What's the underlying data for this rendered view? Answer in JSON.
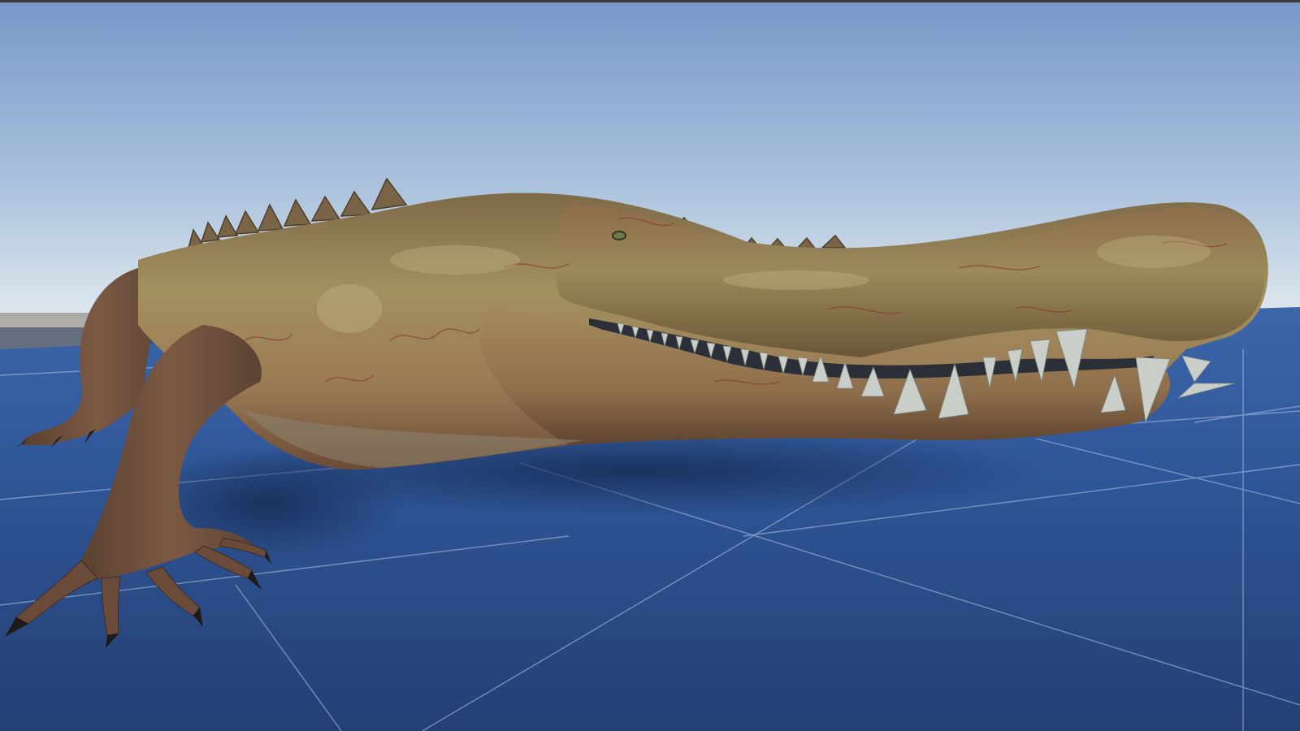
{
  "scene": {
    "viewport": "scene-viewport",
    "subject_icon": "crocodile-model-icon",
    "ground_icon": "grid-plane-icon"
  },
  "colors": {
    "sky_top": "#7c9fce",
    "sky_horizon": "#dbe6ef",
    "ground_near": "#25467f",
    "ground_far": "#3a64a9",
    "grid_line": "#9fb6dc",
    "skin_dark": "#5a4532",
    "skin_mid": "#8a7650",
    "skin_light": "#b3a071",
    "skin_red": "#8c3a33",
    "teeth": "#c9cec9",
    "top_border": "#3a3a3a"
  }
}
